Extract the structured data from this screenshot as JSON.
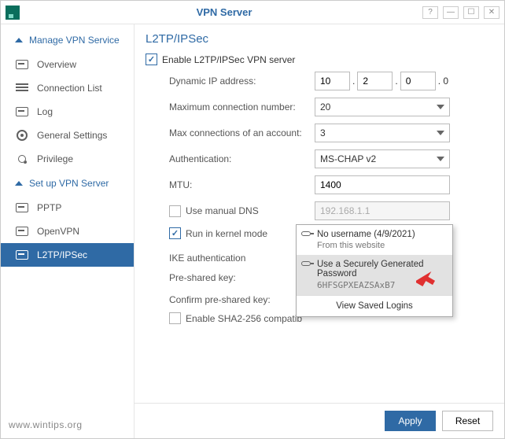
{
  "window": {
    "title": "VPN Server"
  },
  "sidebar": {
    "section1_label": "Manage VPN Service",
    "overview": "Overview",
    "connection_list": "Connection List",
    "log": "Log",
    "general_settings": "General Settings",
    "privilege": "Privilege",
    "section2_label": "Set up VPN Server",
    "pptp": "PPTP",
    "openvpn": "OpenVPN",
    "l2tp": "L2TP/IPSec"
  },
  "page": {
    "title": "L2TP/IPSec",
    "enable_label": "Enable L2TP/IPSec VPN server",
    "rows": {
      "dyn_ip_label": "Dynamic IP address:",
      "dyn_ip": {
        "a": "10",
        "b": "2",
        "c": "0",
        "suffix": ". 0"
      },
      "max_conn_label": "Maximum connection number:",
      "max_conn_value": "20",
      "max_acc_label": "Max connections of an account:",
      "max_acc_value": "3",
      "auth_label": "Authentication:",
      "auth_value": "MS-CHAP v2",
      "mtu_label": "MTU:",
      "mtu_value": "1400",
      "manual_dns_label": "Use manual DNS",
      "manual_dns_value": "192.168.1.1",
      "kernel_label": "Run in kernel mode",
      "ike_section": "IKE authentication",
      "psk_label": "Pre-shared key:",
      "cpsk_label": "Confirm pre-shared key:",
      "sha_label": "Enable SHA2-256 compatib"
    }
  },
  "popup": {
    "item1_t1": "No username (4/9/2021)",
    "item1_t2": "From this website",
    "item2_t1": "Use a Securely Generated Password",
    "item2_t2": "6HFSGPXEAZSAxB7",
    "footer": "View Saved Logins"
  },
  "footer": {
    "apply": "Apply",
    "reset": "Reset"
  },
  "meta": {
    "wm1": "www.wintips.org"
  }
}
